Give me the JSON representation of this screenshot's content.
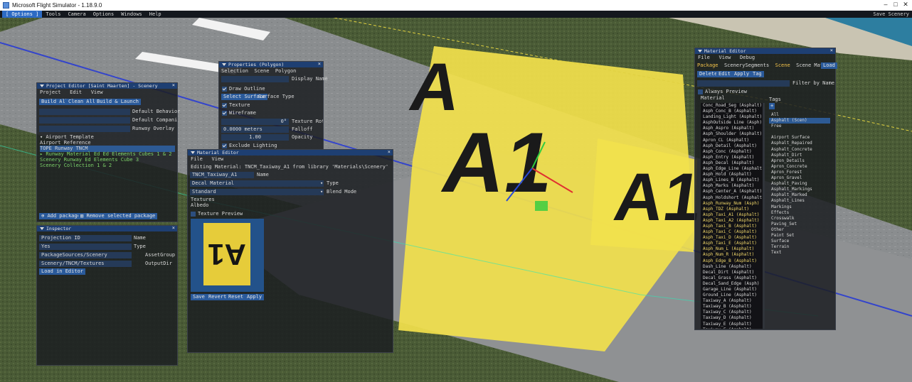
{
  "titlebar": {
    "title": "Microsoft Flight Simulator - 1.18.9.0",
    "minimize": "–",
    "maximize": "□",
    "close": "✕"
  },
  "menubar": {
    "items": [
      "[ Options ]",
      "Tools",
      "Camera",
      "Options",
      "Windows",
      "Help"
    ],
    "right_text": "Save Scenery"
  },
  "project_editor": {
    "title": "Project Editor [Saint Maarten] - Scenery",
    "menu": [
      "Project",
      "Edit",
      "View"
    ],
    "buttons": [
      "Build All",
      "Clean All",
      "Build & Launch"
    ],
    "fields": [
      {
        "value": "",
        "label": "Default Behavior"
      },
      {
        "value": "",
        "label": "Default Companies"
      },
      {
        "value": "",
        "label": "Runway Overlay Texture"
      }
    ],
    "tree": [
      "▾ Airport Template",
      "  Airport Reference",
      "  TOPE Runway TNCM",
      "  ▸ Runway Material Ed Ed Elements Cubes 1 & 2",
      "  Scenery Runway Ed Elements Cube 3",
      "  Scenery Collection 1 & 2"
    ],
    "add_button": "Add package",
    "remove_button": "Remove selected package"
  },
  "inspector": {
    "title": "Inspector",
    "rows": [
      {
        "value": "Projection ID",
        "label": "Name"
      },
      {
        "value": "Yes",
        "label": "Type"
      },
      {
        "value": "PackageSources/Scenery",
        "label": "AssetGroup"
      },
      {
        "value": "Scenery/TNCM/Textures",
        "label": "OutputDir"
      }
    ],
    "button": "Load in Editor"
  },
  "properties": {
    "title": "Properties (Polygon)",
    "tabs": [
      "Selection",
      "Scene",
      "Polygon",
      "Display Name"
    ],
    "checks": [
      {
        "checked": true,
        "label": "Draw Outline"
      },
      {
        "checked": false,
        "label": "Surface Type",
        "button": "Select Surface"
      },
      {
        "checked": true,
        "label": "Texture"
      },
      {
        "checked": true,
        "label": "Wireframe"
      },
      {
        "checked": true,
        "label": "Exclude Lighting"
      }
    ],
    "fields": [
      {
        "value": "0°",
        "label": "Texture Rotation"
      },
      {
        "value": "0.0000 meters",
        "label": "Falloff"
      },
      {
        "value": "1.00",
        "label": "Opacity"
      }
    ]
  },
  "material_editor_small": {
    "title": "Material Editor",
    "menu": [
      "File",
      "View"
    ],
    "path_text": "Editing Material: TNCM_Taxiway_A1 from library 'Materials\\Scenery'",
    "name_value": "TNCM_Taxiway_A1",
    "name_label": "Name",
    "combos": [
      {
        "value": "Decal Material",
        "label": "Type"
      },
      {
        "value": "Standard",
        "label": "Blend Mode"
      }
    ],
    "sub_label_1": "Textures",
    "sub_label_2": "Albedo",
    "texture_preview": "Texture Preview",
    "preview_glyph": "A1",
    "actions": [
      "Save",
      "Revert",
      "Reset",
      "Apply"
    ]
  },
  "material_editor_right": {
    "title": "Material Editor",
    "menu": [
      "File",
      "View",
      "Debug"
    ],
    "crumbs": [
      {
        "text": "Package",
        "accent": true
      },
      {
        "text": "ScenerySegments",
        "accent": false
      },
      {
        "text": "Scene",
        "accent": true
      },
      {
        "text": "Scene Material Lib",
        "accent": false
      },
      {
        "text": "Load",
        "accent": false
      }
    ],
    "buttons": [
      "Delete",
      "Edit",
      "Apply",
      "Tag"
    ],
    "filter_placeholder": "Filter by Name...",
    "checkbox_label": "Always Preview",
    "filter_label": "Material",
    "materials": [
      "Conc_Road_Seg (Asphalt)",
      "Asph_Conc_B (Asphalt)",
      "Landing_Light (Asphalt)",
      "AsphOutside Line (Asph)",
      "Asph_Aspro (Asphalt)",
      "Asph_Shoulder (Asphalt)",
      "Apron_CL (Asphalt)",
      "Asph_Detail (Asphalt)",
      "Asph_Conc (Asphalt)",
      "Asph_Entry (Asphalt)",
      "Asph_Decal (Asphalt)",
      "Asph_Edge_Line (Asphalt)",
      "Asph_Hold (Asphalt)",
      "Asph_Lines_B (Asphalt)",
      "Asph_Marks (Asphalt)",
      "Asph_Center_A (Asphalt)",
      "Asph_Holdshort (Asphalt)",
      "Asph_Runway_Num (Asph)",
      "Asph_TDZ (Asphalt)",
      "Asph_Taxi_A1 (Asphalt)",
      "Asph_Taxi_A2 (Asphalt)",
      "Asph_Taxi_B (Asphalt)",
      "Asph_Taxi_C (Asphalt)",
      "Asph_Taxi_D (Asphalt)",
      "Asph_Taxi_E (Asphalt)",
      "Asph_Num_L (Asphalt)",
      "Asph_Num_R (Asphalt)",
      "Asph_Edge_B (Asphalt)",
      "Dash_Line (Asphalt)",
      "Decal_Dirt (Asphalt)",
      "Decal_Grass (Asphalt)",
      "Decal_Sand_Edge (Asph)",
      "Garage_Line (Asphalt)",
      "Ground_Line (Asphalt)",
      "Taxiway_A (Asphalt)",
      "Taxiway_B (Asphalt)",
      "Taxiway_C (Asphalt)",
      "Taxiway_D (Asphalt)",
      "Taxiway_E (Asphalt)",
      "Taxiway_F (Asphalt)"
    ],
    "tags_header": "Tags",
    "tags": [
      "All",
      "Asphalt (Scen)",
      "Free",
      "",
      "Airport Surface",
      "Asphalt_Repaired",
      "Asphalt_Concrete",
      "Asphalt_Dirt",
      "Apron_Details",
      "Apron_Concrete",
      "Apron_Forest",
      "Apron_Gravel",
      "Asphalt_Paving",
      "Asphalt_Markings",
      "Asphalt_Marked",
      "Asphalt_Lines",
      "Markings",
      "Effects",
      "Crosswalk",
      "Paving_Set",
      "Other",
      "Paint Set",
      "Surface",
      "Terrain",
      "Text"
    ],
    "add_tag": "+"
  },
  "colors": {
    "accent": "#2d6bc4",
    "title_active": "#1e3f72",
    "field": "#253a58",
    "marking": "#f2e14c"
  }
}
